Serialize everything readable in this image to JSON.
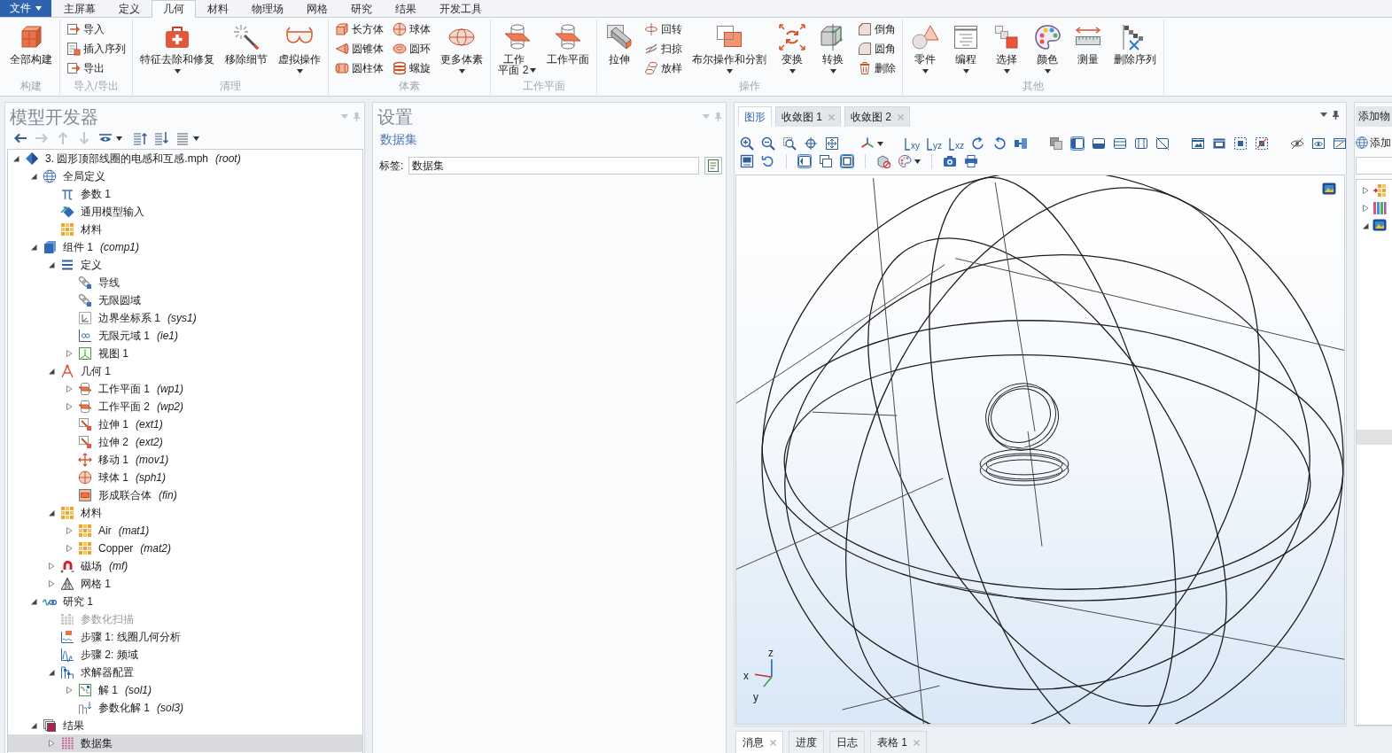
{
  "ribbon": {
    "file_button": "文件",
    "tabs": [
      {
        "label": "主屏幕",
        "selected": false
      },
      {
        "label": "定义",
        "selected": false
      },
      {
        "label": "几何",
        "selected": true
      },
      {
        "label": "材料",
        "selected": false
      },
      {
        "label": "物理场",
        "selected": false
      },
      {
        "label": "网格",
        "selected": false
      },
      {
        "label": "研究",
        "selected": false
      },
      {
        "label": "结果",
        "selected": false
      },
      {
        "label": "开发工具",
        "selected": false
      }
    ],
    "groups": [
      {
        "label": "构建",
        "items": [
          {
            "kind": "large",
            "label": "全部构建",
            "dropdown": false
          }
        ]
      },
      {
        "label": "导入/导出",
        "items": [
          {
            "kind": "stack",
            "entries": [
              "导入",
              "插入序列",
              "导出"
            ]
          }
        ]
      },
      {
        "label": "清理",
        "items": [
          {
            "kind": "large",
            "label": "特征去除和修复",
            "dropdown": true
          },
          {
            "kind": "large",
            "label": "移除细节",
            "dropdown": false
          },
          {
            "kind": "large",
            "label": "虚拟操作",
            "dropdown": true
          }
        ]
      },
      {
        "label": "体素",
        "items": [
          {
            "kind": "stack",
            "entries": [
              "长方体",
              "圆锥体",
              "圆柱体"
            ]
          },
          {
            "kind": "stack",
            "entries": [
              "球体",
              "圆环",
              "螺旋"
            ]
          },
          {
            "kind": "large",
            "label": "更多体素",
            "dropdown": true
          }
        ]
      },
      {
        "label": "工作平面",
        "items": [
          {
            "kind": "wrapped",
            "label": "工作平面 2",
            "dropdown": true
          },
          {
            "kind": "large",
            "label": "工作平面",
            "dropdown": false
          }
        ]
      },
      {
        "label": "操作",
        "items": [
          {
            "kind": "large",
            "label": "拉伸",
            "dropdown": false
          },
          {
            "kind": "stack",
            "entries": [
              "回转",
              "扫掠",
              "放样"
            ]
          },
          {
            "kind": "large",
            "label": "布尔操作和分割",
            "dropdown": true
          },
          {
            "kind": "large",
            "label": "变换",
            "dropdown": true
          },
          {
            "kind": "large",
            "label": "转换",
            "dropdown": true
          },
          {
            "kind": "stack",
            "entries": [
              "倒角",
              "圆角",
              "删除"
            ]
          }
        ]
      },
      {
        "label": "其他",
        "items": [
          {
            "kind": "large",
            "label": "零件",
            "dropdown": true
          },
          {
            "kind": "large",
            "label": "编程",
            "dropdown": true
          },
          {
            "kind": "large",
            "label": "选择",
            "dropdown": true
          },
          {
            "kind": "large",
            "label": "颜色",
            "dropdown": true
          },
          {
            "kind": "large",
            "label": "测量",
            "dropdown": false
          },
          {
            "kind": "large",
            "label": "删除序列",
            "dropdown": false
          }
        ]
      }
    ]
  },
  "model_builder": {
    "title": "模型开发器",
    "toolbar": [
      {
        "disabled": false,
        "dropdown": false
      },
      {
        "disabled": true,
        "dropdown": false
      },
      {
        "disabled": true,
        "dropdown": false
      },
      {
        "disabled": true,
        "dropdown": false
      },
      {
        "disabled": false,
        "dropdown": true
      },
      {
        "disabled": false,
        "dropdown": false
      },
      {
        "disabled": false,
        "dropdown": false
      },
      {
        "disabled": false,
        "dropdown": true
      }
    ],
    "tree": [
      {
        "label": "3. 圆形顶部线圈的电感和互感.mph",
        "tag": "(root)",
        "expanded": true,
        "selected": false,
        "disabled": false,
        "children": [
          {
            "label": "全局定义",
            "expanded": true,
            "selected": false,
            "disabled": false,
            "children": [
              {
                "label": "参数 1",
                "selected": false,
                "disabled": false
              },
              {
                "label": "通用模型输入",
                "selected": false,
                "disabled": false
              },
              {
                "label": "材料",
                "selected": false,
                "disabled": false
              }
            ]
          },
          {
            "label": "组件 1",
            "tag": "(comp1)",
            "expanded": true,
            "selected": false,
            "disabled": false,
            "children": [
              {
                "label": "定义",
                "expanded": true,
                "selected": false,
                "disabled": false,
                "children": [
                  {
                    "label": "导线",
                    "selected": false,
                    "disabled": false
                  },
                  {
                    "label": "无限圆域",
                    "selected": false,
                    "disabled": false
                  },
                  {
                    "label": "边界坐标系 1",
                    "tag": "(sys1)",
                    "selected": false,
                    "disabled": false
                  },
                  {
                    "label": "无限元域 1",
                    "tag": "(ie1)",
                    "selected": false,
                    "disabled": false
                  },
                  {
                    "label": "视图 1",
                    "expanded": false,
                    "selected": false,
                    "disabled": false
                  }
                ]
              },
              {
                "label": "几何 1",
                "expanded": true,
                "selected": false,
                "disabled": false,
                "children": [
                  {
                    "label": "工作平面 1",
                    "tag": "(wp1)",
                    "expanded": false,
                    "selected": false,
                    "disabled": false
                  },
                  {
                    "label": "工作平面 2",
                    "tag": "(wp2)",
                    "expanded": false,
                    "selected": false,
                    "disabled": false
                  },
                  {
                    "label": "拉伸 1",
                    "tag": "(ext1)",
                    "selected": false,
                    "disabled": false
                  },
                  {
                    "label": "拉伸 2",
                    "tag": "(ext2)",
                    "selected": false,
                    "disabled": false
                  },
                  {
                    "label": "移动 1",
                    "tag": "(mov1)",
                    "selected": false,
                    "disabled": false
                  },
                  {
                    "label": "球体 1",
                    "tag": "(sph1)",
                    "selected": false,
                    "disabled": false
                  },
                  {
                    "label": "形成联合体",
                    "tag": "(fin)",
                    "selected": false,
                    "disabled": false
                  }
                ]
              },
              {
                "label": "材料",
                "expanded": true,
                "selected": false,
                "disabled": false,
                "children": [
                  {
                    "label": "Air",
                    "tag": "(mat1)",
                    "expanded": false,
                    "selected": false,
                    "disabled": false
                  },
                  {
                    "label": "Copper",
                    "tag": "(mat2)",
                    "expanded": false,
                    "selected": false,
                    "disabled": false
                  }
                ]
              },
              {
                "label": "磁场",
                "tag": "(mf)",
                "expanded": false,
                "selected": false,
                "disabled": false
              },
              {
                "label": "网格 1",
                "expanded": false,
                "selected": false,
                "disabled": false
              }
            ]
          },
          {
            "label": "研究 1",
            "expanded": true,
            "selected": false,
            "disabled": false,
            "children": [
              {
                "label": "参数化扫描",
                "selected": false,
                "disabled": true
              },
              {
                "label": "步骤 1: 线圈几何分析",
                "selected": false,
                "disabled": false
              },
              {
                "label": "步骤 2: 频域",
                "selected": false,
                "disabled": false
              },
              {
                "label": "求解器配置",
                "expanded": true,
                "selected": false,
                "disabled": false,
                "children": [
                  {
                    "label": "解 1",
                    "tag": "(sol1)",
                    "expanded": false,
                    "selected": false,
                    "disabled": false
                  },
                  {
                    "label": "参数化解 1",
                    "tag": "(sol3)",
                    "selected": false,
                    "disabled": false
                  }
                ]
              }
            ]
          },
          {
            "label": "结果",
            "expanded": true,
            "selected": false,
            "disabled": false,
            "children": [
              {
                "label": "数据集",
                "expanded": false,
                "selected": true,
                "disabled": false
              }
            ]
          }
        ]
      }
    ]
  },
  "settings": {
    "title": "设置",
    "subtitle": "数据集",
    "field": {
      "label": "标签:",
      "value": "数据集"
    }
  },
  "graphics": {
    "tabs": [
      {
        "label": "图形",
        "selected": true,
        "closable": false
      },
      {
        "label": "收敛图 1",
        "selected": false,
        "closable": true
      },
      {
        "label": "收敛图 2",
        "selected": false,
        "closable": true
      }
    ],
    "toolbar": [
      [
        [
          {
            "on": false,
            "dropdown": false
          },
          {
            "on": false,
            "dropdown": false
          },
          {
            "on": false,
            "dropdown": false
          },
          {
            "on": false,
            "dropdown": false
          },
          {
            "on": false,
            "dropdown": false
          }
        ],
        [
          {
            "on": false,
            "dropdown": true
          }
        ],
        [
          {
            "label": "xy",
            "on": false,
            "dropdown": false
          },
          {
            "label": "yz",
            "on": false,
            "dropdown": false
          },
          {
            "label": "xz",
            "on": false,
            "dropdown": false
          },
          {
            "on": false,
            "dropdown": false
          },
          {
            "on": false,
            "dropdown": false
          },
          {
            "on": false,
            "dropdown": false
          }
        ],
        [
          {
            "on": false,
            "dropdown": false
          },
          {
            "on": true,
            "dropdown": false
          },
          {
            "on": false,
            "dropdown": false
          },
          {
            "on": false,
            "dropdown": false
          },
          {
            "on": false,
            "dropdown": false
          },
          {
            "on": false,
            "dropdown": false
          }
        ],
        [
          {
            "on": false,
            "dropdown": false
          },
          {
            "on": false,
            "dropdown": false
          },
          {
            "on": false,
            "dropdown": false
          },
          {
            "on": false,
            "dropdown": false
          }
        ],
        [
          {
            "on": false,
            "dropdown": false
          },
          {
            "on": false,
            "dropdown": false
          },
          {
            "on": false,
            "dropdown": false
          }
        ]
      ],
      [
        [
          {
            "on": false,
            "dropdown": false
          },
          {
            "on": false,
            "dropdown": false
          }
        ],
        [
          {
            "on": true,
            "dropdown": false
          },
          {
            "on": false,
            "dropdown": false
          },
          {
            "on": true,
            "dropdown": false
          }
        ],
        [
          {
            "on": false,
            "dropdown": false
          },
          {
            "on": false,
            "dropdown": true
          }
        ],
        [
          {
            "on": false,
            "dropdown": false
          },
          {
            "on": false,
            "dropdown": false
          }
        ]
      ]
    ],
    "axes": [
      "z",
      "x",
      "y"
    ]
  },
  "bottom_panel": {
    "tabs": [
      {
        "label": "消息",
        "selected": true,
        "closable": true
      },
      {
        "label": "进度",
        "selected": false,
        "closable": false
      },
      {
        "label": "日志",
        "selected": false,
        "closable": false
      },
      {
        "label": "表格 1",
        "selected": false,
        "closable": true
      }
    ]
  },
  "right_panel": {
    "title": "添加物",
    "button": "添加",
    "tree": [
      {
        "expanded": false,
        "selected": false
      },
      {
        "expanded": false,
        "selected": false
      },
      {
        "expanded": true,
        "selected": false
      }
    ]
  }
}
